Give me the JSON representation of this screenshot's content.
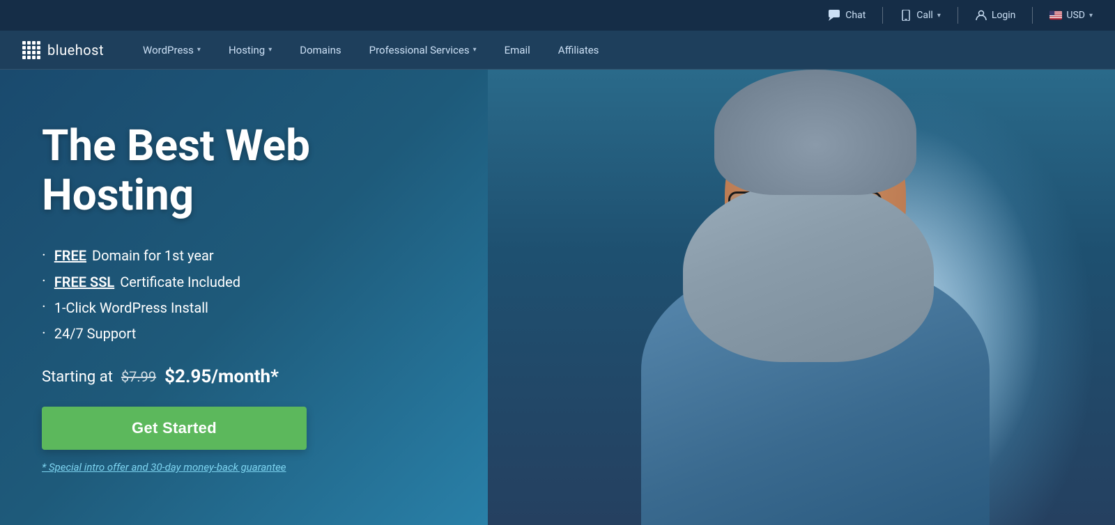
{
  "topbar": {
    "chat_label": "Chat",
    "call_label": "Call",
    "login_label": "Login",
    "currency_label": "USD"
  },
  "nav": {
    "logo_text": "bluehost",
    "items": [
      {
        "label": "WordPress",
        "has_dropdown": true
      },
      {
        "label": "Hosting",
        "has_dropdown": true
      },
      {
        "label": "Domains",
        "has_dropdown": false
      },
      {
        "label": "Professional Services",
        "has_dropdown": true
      },
      {
        "label": "Email",
        "has_dropdown": false
      },
      {
        "label": "Affiliates",
        "has_dropdown": false
      }
    ]
  },
  "hero": {
    "title": "The Best Web Hosting",
    "features": [
      {
        "highlight": "FREE",
        "rest": " Domain for 1st year"
      },
      {
        "highlight": "FREE SSL",
        "rest": " Certificate Included"
      },
      {
        "highlight": "",
        "rest": "1-Click WordPress Install"
      },
      {
        "highlight": "",
        "rest": "24/7 Support"
      }
    ],
    "pricing_prefix": "Starting at",
    "old_price": "$7.99",
    "new_price": "$2.95/month*",
    "cta_button": "Get Started",
    "guarantee": "* Special intro offer and 30-day money-back guarantee"
  },
  "colors": {
    "nav_bg": "#1e3f5c",
    "topbar_bg": "#152d47",
    "hero_bg": "#1a4a6e",
    "cta_green": "#5cb85c",
    "link_blue": "#7dd4f0"
  }
}
